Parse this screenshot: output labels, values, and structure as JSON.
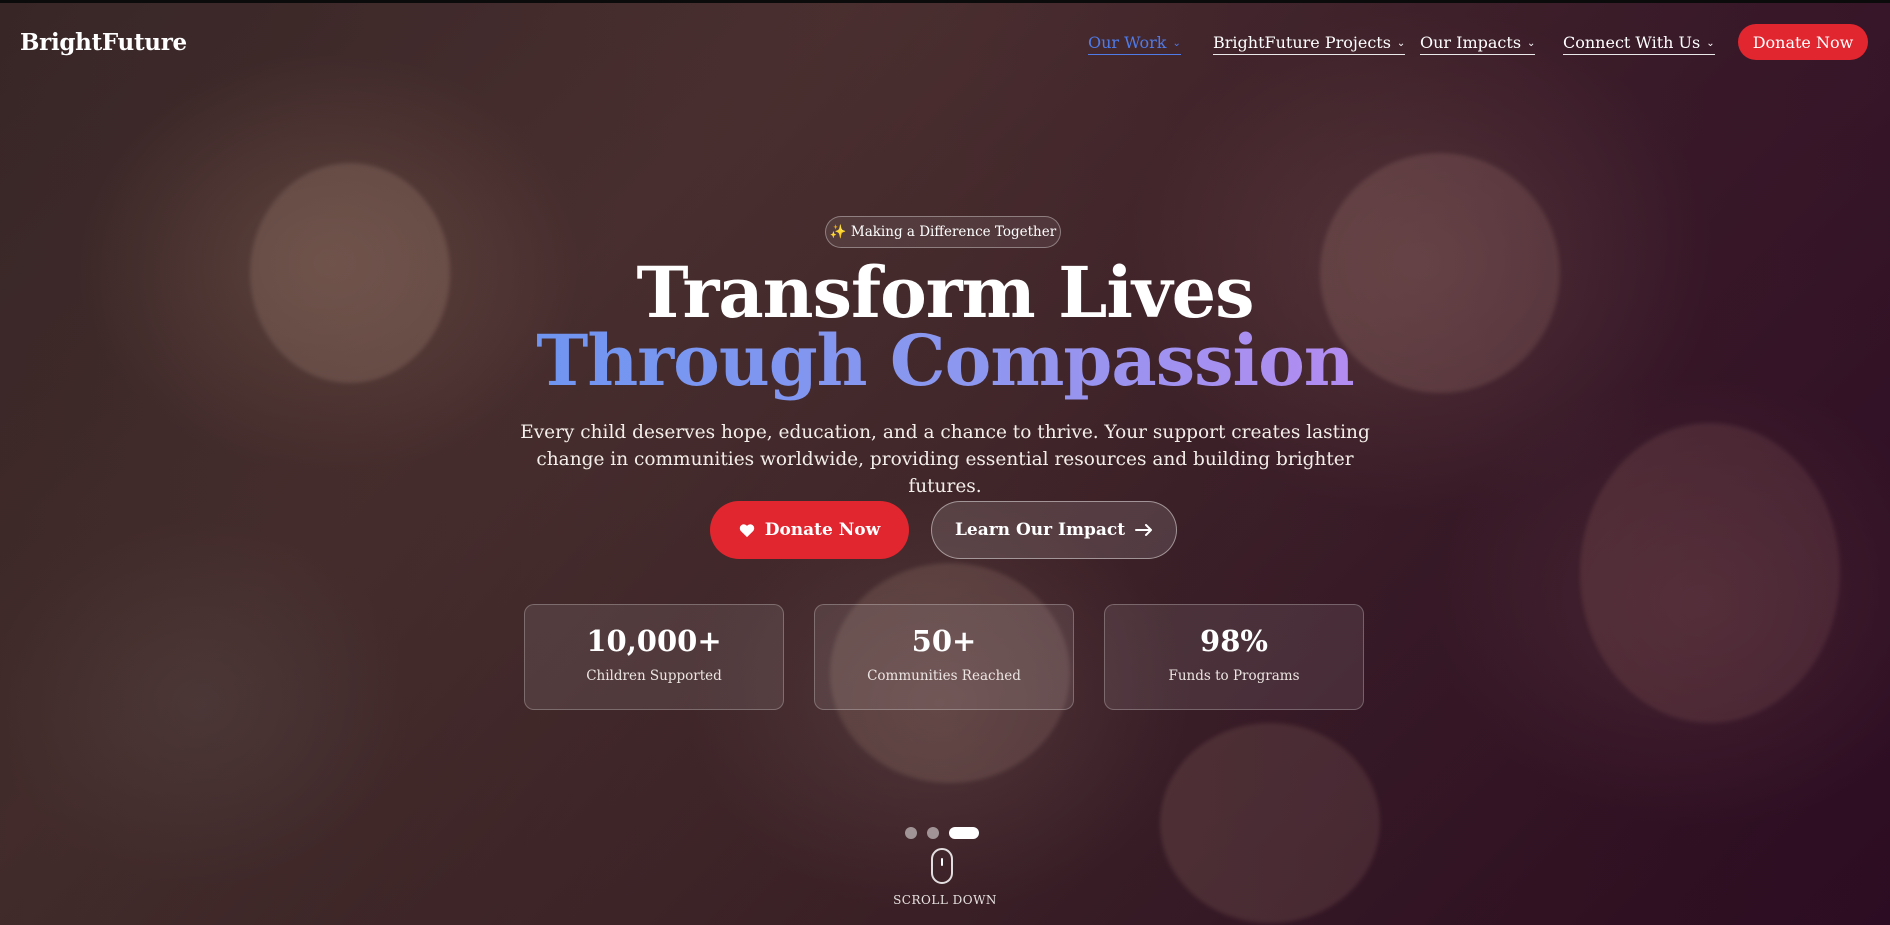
{
  "brand": {
    "logo": "BrightFuture"
  },
  "nav": {
    "items": [
      {
        "label": "Our Work",
        "active": true
      },
      {
        "label": "BrightFuture Projects",
        "active": false
      },
      {
        "label": "Our Impacts",
        "active": false
      },
      {
        "label": "Connect With Us",
        "active": false
      }
    ],
    "donate_label": "Donate Now"
  },
  "hero": {
    "badge": "✨ Making a Difference Together",
    "title_line1": "Transform Lives",
    "title_line2": "Through Compassion",
    "subtitle": "Every child deserves hope, education, and a chance to thrive. Your support creates lasting change in communities worldwide, providing essential resources and building brighter futures.",
    "donate_label": "Donate Now",
    "learn_label": "Learn Our Impact",
    "learn_icon": "arrow-right-icon",
    "donate_icon": "heart-icon"
  },
  "stats": [
    {
      "value": "10,000+",
      "label": "Children Supported"
    },
    {
      "value": "50+",
      "label": "Communities Reached"
    },
    {
      "value": "98%",
      "label": "Funds to Programs"
    }
  ],
  "carousel": {
    "slides": 3,
    "active_index": 2
  },
  "scroll": {
    "label": "SCROLL DOWN"
  },
  "colors": {
    "accent_red": "#e1262f",
    "nav_active": "#4f7be8",
    "gradient_start": "#6f95f1",
    "gradient_end": "#b38cf0"
  }
}
